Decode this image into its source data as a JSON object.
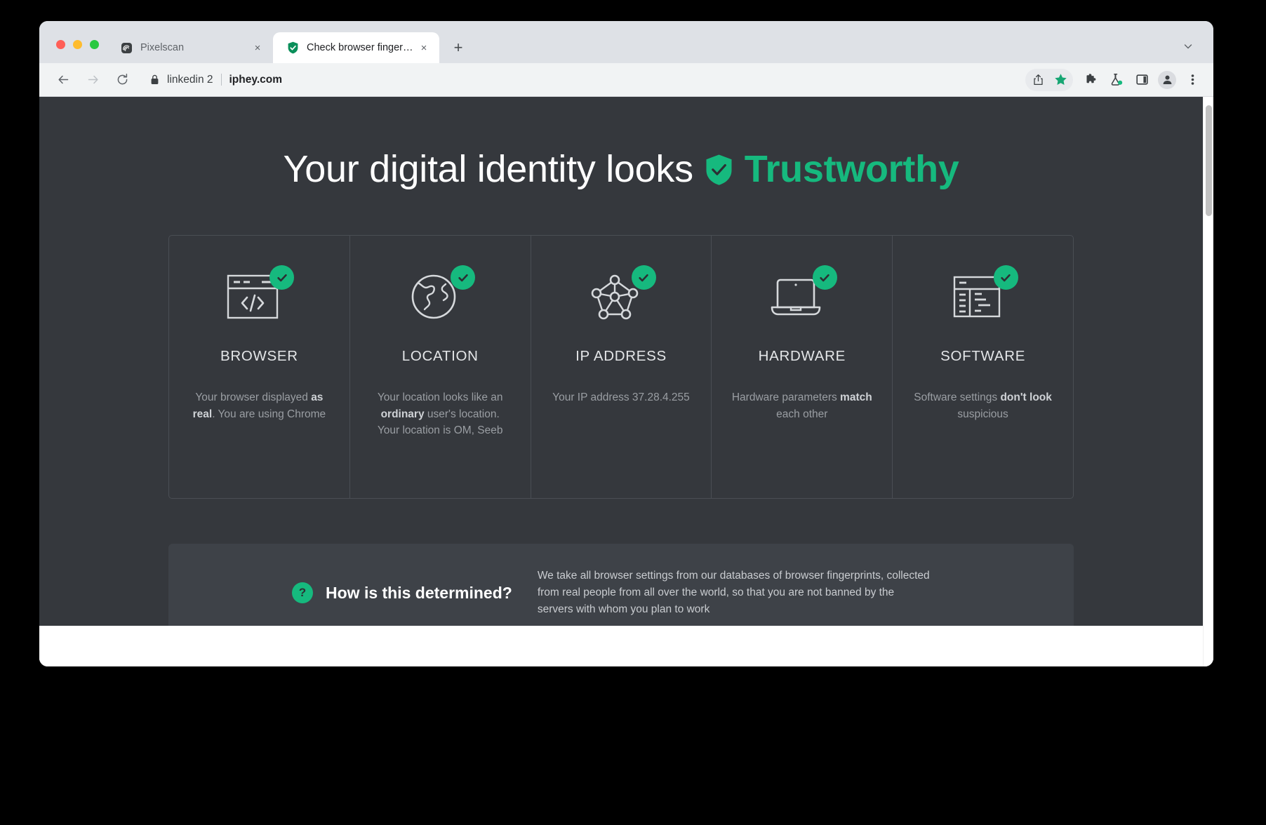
{
  "browser": {
    "tabs": [
      {
        "title": "Pixelscan",
        "favicon": "pixelscan-icon",
        "active": false,
        "close_label": "×"
      },
      {
        "title": "Check browser fingerprints",
        "favicon": "shield-check-icon",
        "active": true,
        "close_label": "×"
      }
    ],
    "new_tab_label": "+",
    "toolbar": {
      "back_label": "←",
      "forward_label": "→",
      "reload_label": "↻",
      "lock_label": "lock-icon",
      "profile_chip": "linkedin 2",
      "url_host": "iphey.com",
      "icons": [
        "share-icon",
        "bookmark-star-icon",
        "extensions-puzzle-icon",
        "lab-flask-icon",
        "side-panel-icon",
        "profile-avatar-icon",
        "more-menu-icon"
      ]
    }
  },
  "accent": {
    "green": "#16b97e",
    "page_bg": "#35383d",
    "panel_bg": "#3e4248",
    "border": "#4a4e54"
  },
  "hero": {
    "prefix": "Your digital identity looks",
    "verdict": "Trustworthy",
    "verdict_icon": "shield-check-icon"
  },
  "cards": [
    {
      "icon": "browser-window-code-icon",
      "status_icon": "check-circle-icon",
      "title": "BROWSER",
      "desc_parts": [
        {
          "text": "Your browser displayed ",
          "bold": false
        },
        {
          "text": "as real",
          "bold": true
        },
        {
          "text": ". You are using Chrome",
          "bold": false
        }
      ]
    },
    {
      "icon": "globe-icon",
      "status_icon": "check-circle-icon",
      "title": "LOCATION",
      "desc_parts": [
        {
          "text": "Your location looks like an ",
          "bold": false
        },
        {
          "text": "ordinary",
          "bold": true
        },
        {
          "text": " user's location. Your location is OM, Seeb",
          "bold": false
        }
      ]
    },
    {
      "icon": "network-nodes-icon",
      "status_icon": "check-circle-icon",
      "title": "IP ADDRESS",
      "desc_parts": [
        {
          "text": "Your IP address 37.28.4.255",
          "bold": false
        }
      ]
    },
    {
      "icon": "laptop-icon",
      "status_icon": "check-circle-icon",
      "title": "HARDWARE",
      "desc_parts": [
        {
          "text": "Hardware parameters ",
          "bold": false
        },
        {
          "text": "match",
          "bold": true
        },
        {
          "text": " each other",
          "bold": false
        }
      ]
    },
    {
      "icon": "app-window-list-icon",
      "status_icon": "check-circle-icon",
      "title": "SOFTWARE",
      "desc_parts": [
        {
          "text": "Software settings ",
          "bold": false
        },
        {
          "text": "don't look",
          "bold": true
        },
        {
          "text": " suspicious",
          "bold": false
        }
      ]
    }
  ],
  "info_panel": {
    "badge": "?",
    "title": "How is this determined?",
    "text": "We take all browser settings from our databases of browser fingerprints, collected from real people from all over the world, so that you are not banned by the servers with whom you plan to work"
  }
}
